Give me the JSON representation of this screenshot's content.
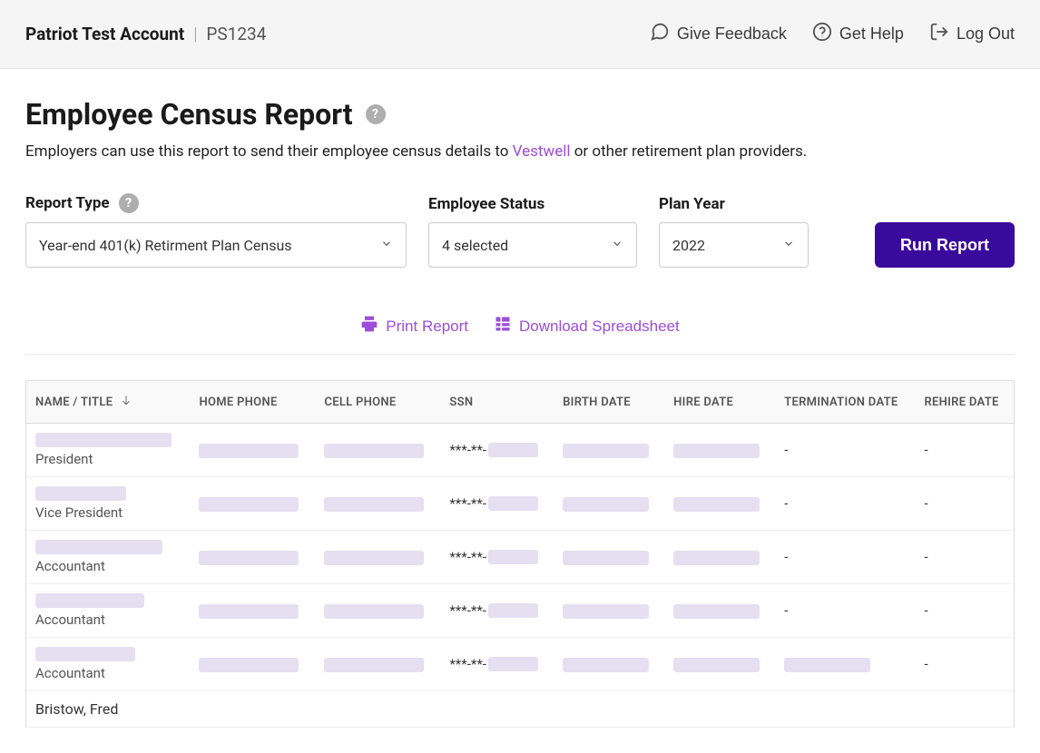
{
  "header": {
    "account_name": "Patriot Test Account",
    "account_id": "PS1234",
    "actions": {
      "feedback": "Give Feedback",
      "help": "Get Help",
      "logout": "Log Out"
    }
  },
  "page": {
    "title": "Employee Census Report",
    "desc_before": "Employers can use this report to send their employee census details to ",
    "desc_link": "Vestwell",
    "desc_after": " or other retirement plan providers.",
    "help_glyph": "?"
  },
  "filters": {
    "report_type": {
      "label": "Report Type",
      "value": "Year-end 401(k) Retirment Plan Census"
    },
    "employee_status": {
      "label": "Employee Status",
      "value": "4 selected"
    },
    "plan_year": {
      "label": "Plan Year",
      "value": "2022"
    },
    "run_button": "Run Report"
  },
  "table_actions": {
    "print": "Print Report",
    "download": "Download Spreadsheet"
  },
  "table": {
    "headers": {
      "name": "NAME / TITLE",
      "home_phone": "HOME PHONE",
      "cell_phone": "CELL PHONE",
      "ssn": "SSN",
      "birth_date": "BIRTH DATE",
      "hire_date": "HIRE DATE",
      "term_date": "TERMINATION DATE",
      "rehire_date": "REHIRE DATE"
    },
    "rows": [
      {
        "title": "President",
        "ssn_mask": "***-**-",
        "term": "-",
        "rehire": "-",
        "term_redacted": false,
        "name_width": "rw-150",
        "ssn_tail_w": "rw-55"
      },
      {
        "title": "Vice President",
        "ssn_mask": "***-**-",
        "term": "-",
        "rehire": "-",
        "term_redacted": false,
        "name_width": "rw-100",
        "ssn_tail_w": "rw-55"
      },
      {
        "title": "Accountant",
        "ssn_mask": "***-**-",
        "term": "-",
        "rehire": "-",
        "term_redacted": false,
        "name_width": "rw-140",
        "ssn_tail_w": "rw-55"
      },
      {
        "title": "Accountant",
        "ssn_mask": "***-**-",
        "term": "-",
        "rehire": "-",
        "term_redacted": false,
        "name_width": "rw-120",
        "ssn_tail_w": "rw-55"
      },
      {
        "title": "Accountant",
        "ssn_mask": "***-**-",
        "term": "",
        "rehire": "-",
        "term_redacted": true,
        "name_width": "rw-110",
        "ssn_tail_w": "rw-55"
      }
    ],
    "cutoff_name": "Bristow, Fred"
  }
}
